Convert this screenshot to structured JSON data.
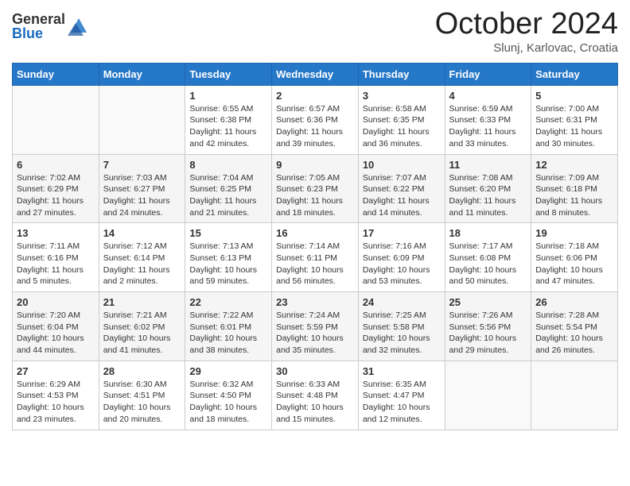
{
  "header": {
    "logo_general": "General",
    "logo_blue": "Blue",
    "month_title": "October 2024",
    "subtitle": "Slunj, Karlovac, Croatia"
  },
  "weekdays": [
    "Sunday",
    "Monday",
    "Tuesday",
    "Wednesday",
    "Thursday",
    "Friday",
    "Saturday"
  ],
  "weeks": [
    [
      {
        "day": "",
        "sunrise": "",
        "sunset": "",
        "daylight": ""
      },
      {
        "day": "",
        "sunrise": "",
        "sunset": "",
        "daylight": ""
      },
      {
        "day": "1",
        "sunrise": "Sunrise: 6:55 AM",
        "sunset": "Sunset: 6:38 PM",
        "daylight": "Daylight: 11 hours and 42 minutes."
      },
      {
        "day": "2",
        "sunrise": "Sunrise: 6:57 AM",
        "sunset": "Sunset: 6:36 PM",
        "daylight": "Daylight: 11 hours and 39 minutes."
      },
      {
        "day": "3",
        "sunrise": "Sunrise: 6:58 AM",
        "sunset": "Sunset: 6:35 PM",
        "daylight": "Daylight: 11 hours and 36 minutes."
      },
      {
        "day": "4",
        "sunrise": "Sunrise: 6:59 AM",
        "sunset": "Sunset: 6:33 PM",
        "daylight": "Daylight: 11 hours and 33 minutes."
      },
      {
        "day": "5",
        "sunrise": "Sunrise: 7:00 AM",
        "sunset": "Sunset: 6:31 PM",
        "daylight": "Daylight: 11 hours and 30 minutes."
      }
    ],
    [
      {
        "day": "6",
        "sunrise": "Sunrise: 7:02 AM",
        "sunset": "Sunset: 6:29 PM",
        "daylight": "Daylight: 11 hours and 27 minutes."
      },
      {
        "day": "7",
        "sunrise": "Sunrise: 7:03 AM",
        "sunset": "Sunset: 6:27 PM",
        "daylight": "Daylight: 11 hours and 24 minutes."
      },
      {
        "day": "8",
        "sunrise": "Sunrise: 7:04 AM",
        "sunset": "Sunset: 6:25 PM",
        "daylight": "Daylight: 11 hours and 21 minutes."
      },
      {
        "day": "9",
        "sunrise": "Sunrise: 7:05 AM",
        "sunset": "Sunset: 6:23 PM",
        "daylight": "Daylight: 11 hours and 18 minutes."
      },
      {
        "day": "10",
        "sunrise": "Sunrise: 7:07 AM",
        "sunset": "Sunset: 6:22 PM",
        "daylight": "Daylight: 11 hours and 14 minutes."
      },
      {
        "day": "11",
        "sunrise": "Sunrise: 7:08 AM",
        "sunset": "Sunset: 6:20 PM",
        "daylight": "Daylight: 11 hours and 11 minutes."
      },
      {
        "day": "12",
        "sunrise": "Sunrise: 7:09 AM",
        "sunset": "Sunset: 6:18 PM",
        "daylight": "Daylight: 11 hours and 8 minutes."
      }
    ],
    [
      {
        "day": "13",
        "sunrise": "Sunrise: 7:11 AM",
        "sunset": "Sunset: 6:16 PM",
        "daylight": "Daylight: 11 hours and 5 minutes."
      },
      {
        "day": "14",
        "sunrise": "Sunrise: 7:12 AM",
        "sunset": "Sunset: 6:14 PM",
        "daylight": "Daylight: 11 hours and 2 minutes."
      },
      {
        "day": "15",
        "sunrise": "Sunrise: 7:13 AM",
        "sunset": "Sunset: 6:13 PM",
        "daylight": "Daylight: 10 hours and 59 minutes."
      },
      {
        "day": "16",
        "sunrise": "Sunrise: 7:14 AM",
        "sunset": "Sunset: 6:11 PM",
        "daylight": "Daylight: 10 hours and 56 minutes."
      },
      {
        "day": "17",
        "sunrise": "Sunrise: 7:16 AM",
        "sunset": "Sunset: 6:09 PM",
        "daylight": "Daylight: 10 hours and 53 minutes."
      },
      {
        "day": "18",
        "sunrise": "Sunrise: 7:17 AM",
        "sunset": "Sunset: 6:08 PM",
        "daylight": "Daylight: 10 hours and 50 minutes."
      },
      {
        "day": "19",
        "sunrise": "Sunrise: 7:18 AM",
        "sunset": "Sunset: 6:06 PM",
        "daylight": "Daylight: 10 hours and 47 minutes."
      }
    ],
    [
      {
        "day": "20",
        "sunrise": "Sunrise: 7:20 AM",
        "sunset": "Sunset: 6:04 PM",
        "daylight": "Daylight: 10 hours and 44 minutes."
      },
      {
        "day": "21",
        "sunrise": "Sunrise: 7:21 AM",
        "sunset": "Sunset: 6:02 PM",
        "daylight": "Daylight: 10 hours and 41 minutes."
      },
      {
        "day": "22",
        "sunrise": "Sunrise: 7:22 AM",
        "sunset": "Sunset: 6:01 PM",
        "daylight": "Daylight: 10 hours and 38 minutes."
      },
      {
        "day": "23",
        "sunrise": "Sunrise: 7:24 AM",
        "sunset": "Sunset: 5:59 PM",
        "daylight": "Daylight: 10 hours and 35 minutes."
      },
      {
        "day": "24",
        "sunrise": "Sunrise: 7:25 AM",
        "sunset": "Sunset: 5:58 PM",
        "daylight": "Daylight: 10 hours and 32 minutes."
      },
      {
        "day": "25",
        "sunrise": "Sunrise: 7:26 AM",
        "sunset": "Sunset: 5:56 PM",
        "daylight": "Daylight: 10 hours and 29 minutes."
      },
      {
        "day": "26",
        "sunrise": "Sunrise: 7:28 AM",
        "sunset": "Sunset: 5:54 PM",
        "daylight": "Daylight: 10 hours and 26 minutes."
      }
    ],
    [
      {
        "day": "27",
        "sunrise": "Sunrise: 6:29 AM",
        "sunset": "Sunset: 4:53 PM",
        "daylight": "Daylight: 10 hours and 23 minutes."
      },
      {
        "day": "28",
        "sunrise": "Sunrise: 6:30 AM",
        "sunset": "Sunset: 4:51 PM",
        "daylight": "Daylight: 10 hours and 20 minutes."
      },
      {
        "day": "29",
        "sunrise": "Sunrise: 6:32 AM",
        "sunset": "Sunset: 4:50 PM",
        "daylight": "Daylight: 10 hours and 18 minutes."
      },
      {
        "day": "30",
        "sunrise": "Sunrise: 6:33 AM",
        "sunset": "Sunset: 4:48 PM",
        "daylight": "Daylight: 10 hours and 15 minutes."
      },
      {
        "day": "31",
        "sunrise": "Sunrise: 6:35 AM",
        "sunset": "Sunset: 4:47 PM",
        "daylight": "Daylight: 10 hours and 12 minutes."
      },
      {
        "day": "",
        "sunrise": "",
        "sunset": "",
        "daylight": ""
      },
      {
        "day": "",
        "sunrise": "",
        "sunset": "",
        "daylight": ""
      }
    ]
  ]
}
